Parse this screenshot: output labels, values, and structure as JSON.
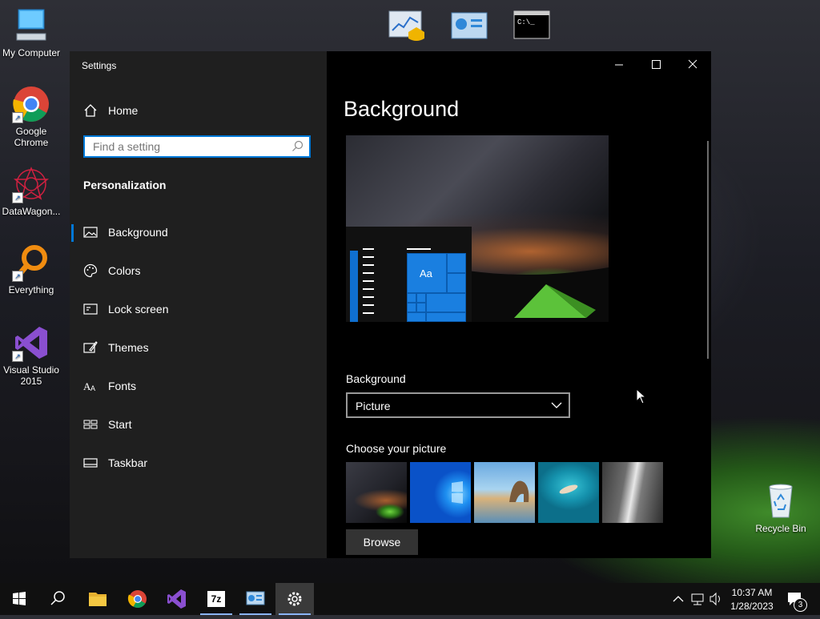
{
  "desktop": {
    "icons": [
      {
        "label": "My Computer"
      },
      {
        "label": "Google Chrome"
      },
      {
        "label": "DataWagon..."
      },
      {
        "label": "Everything"
      },
      {
        "label": "Visual Studio 2015"
      },
      {
        "label": "Recycle Bin"
      }
    ]
  },
  "settings": {
    "window_title": "Settings",
    "home_label": "Home",
    "search_placeholder": "Find a setting",
    "section_title": "Personalization",
    "nav": [
      {
        "label": "Background",
        "icon": "picture-icon",
        "selected": true
      },
      {
        "label": "Colors",
        "icon": "palette-icon"
      },
      {
        "label": "Lock screen",
        "icon": "lock-screen-icon"
      },
      {
        "label": "Themes",
        "icon": "themes-icon"
      },
      {
        "label": "Fonts",
        "icon": "fonts-icon"
      },
      {
        "label": "Start",
        "icon": "start-icon"
      },
      {
        "label": "Taskbar",
        "icon": "taskbar-icon"
      }
    ],
    "content": {
      "heading": "Background",
      "preview_tile_text": "Aa",
      "background_label": "Background",
      "background_value": "Picture",
      "choose_label": "Choose your picture",
      "browse_label": "Browse"
    },
    "accent": "#0078d7"
  },
  "taskbar": {
    "apps": [
      "start-icon",
      "search-icon",
      "file-explorer-icon",
      "chrome-icon",
      "visual-studio-icon",
      "7zip-icon",
      "control-panel-icon",
      "settings-icon"
    ],
    "zip_label": "7z",
    "time": "10:37 AM",
    "date": "1/28/2023",
    "notification_count": "3"
  }
}
